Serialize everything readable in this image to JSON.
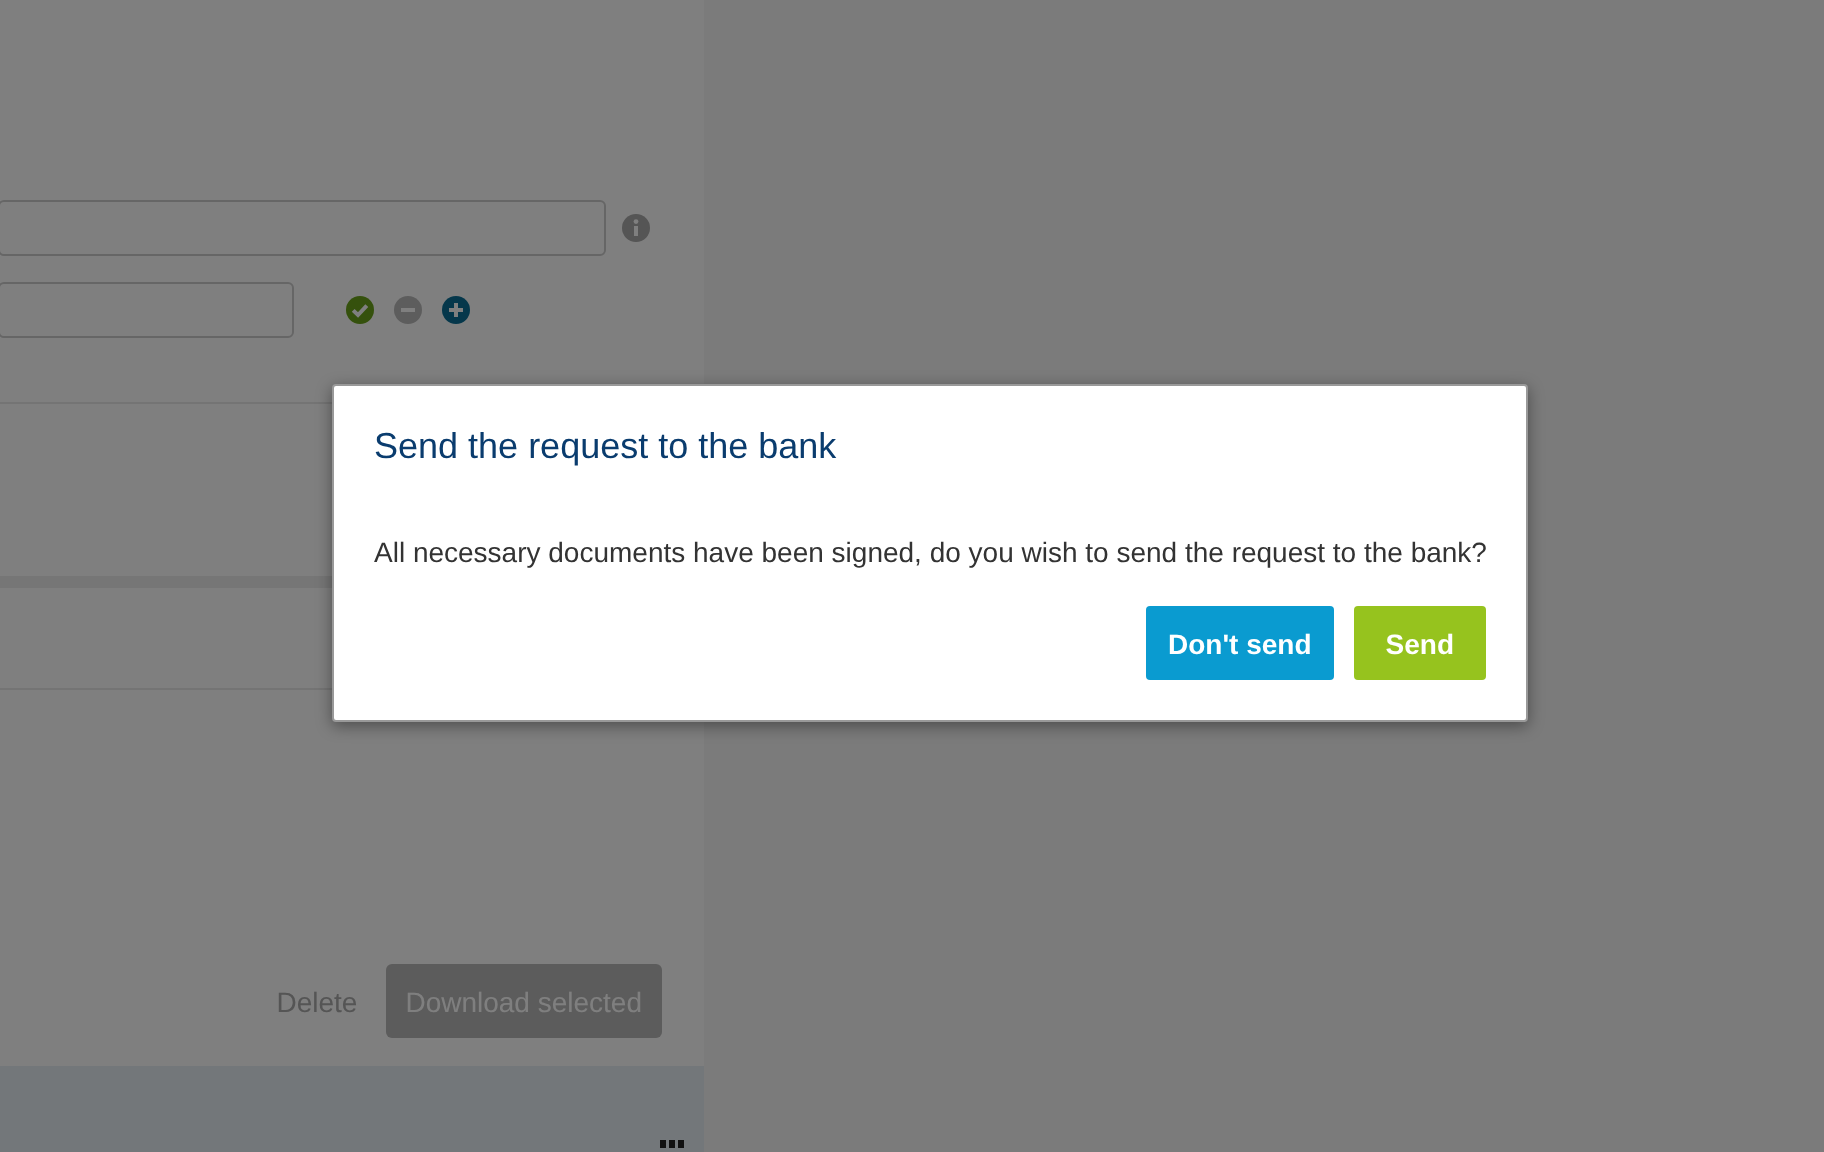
{
  "page": {
    "actions": [
      {
        "kind": "link",
        "label": "Delete",
        "disabled": true
      },
      {
        "kind": "button",
        "label": "Download selected",
        "disabled": true
      }
    ]
  },
  "dialog": {
    "title": "Send the request to the bank",
    "message": "All necessary documents have been signed, do you wish to send the request to the bank?",
    "buttons": [
      {
        "kind": "secondary",
        "label": "Don't send"
      },
      {
        "kind": "primary",
        "label": "Send"
      }
    ]
  }
}
